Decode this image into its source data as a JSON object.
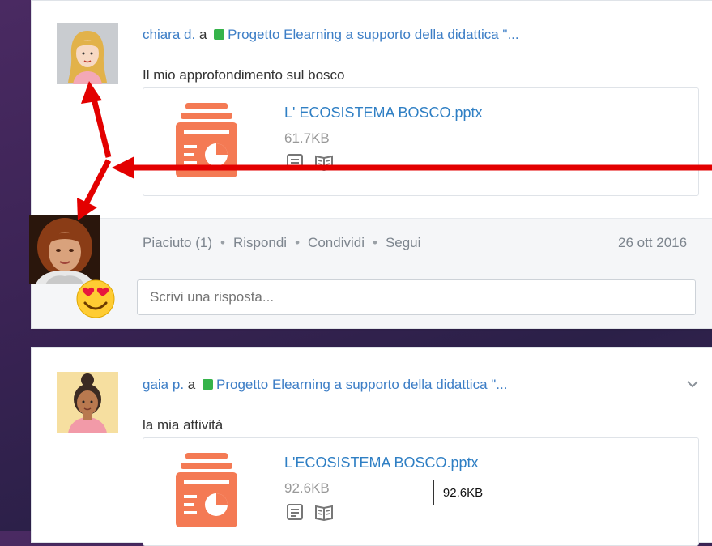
{
  "posts": [
    {
      "author": "chiara d.",
      "connector": "a",
      "group": "Progetto Elearning a supporto della didattica \"...",
      "text": "Il mio approfondimento sul bosco",
      "attachment": {
        "name": "L' ECOSISTEMA BOSCO.pptx",
        "size": "61.7KB"
      },
      "actions": {
        "like": "Piaciuto (1)",
        "reply": "Rispondi",
        "share": "Condividi",
        "follow": "Segui",
        "separator": "•"
      },
      "date": "26 ott 2016",
      "reply_placeholder": "Scrivi una risposta..."
    },
    {
      "author": "gaia p.",
      "connector": "a",
      "group": "Progetto Elearning a supporto della didattica \"...",
      "text": "la mia attività",
      "attachment": {
        "name": "L'ECOSISTEMA BOSCO.pptx",
        "size": "92.6KB"
      }
    }
  ],
  "tooltip": "92.6KB",
  "icons": [
    "file-pptx-icon",
    "preview-icon",
    "book-icon",
    "chevron-down-icon",
    "heart-eyes-emoji-icon"
  ],
  "colors": {
    "link": "#3d7ec6",
    "group_dot": "#35b34a",
    "file_icon": "#f47a54",
    "arrow": "#e30000"
  }
}
